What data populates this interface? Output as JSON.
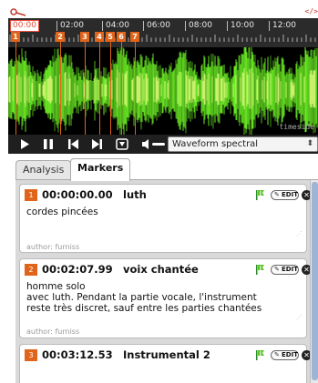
{
  "player": {
    "embed_label": "</>",
    "ruler_ticks": [
      "00:00",
      "02:00",
      "04:00",
      "06:00",
      "08:00",
      "10:00",
      "12:00"
    ],
    "marker_flags": [
      "1",
      "2",
      "3",
      "4",
      "5",
      "6",
      "7"
    ],
    "waveform_brand": "timeside",
    "view_select": {
      "selected": "Waveform spectral"
    },
    "icons": {
      "play": "play-icon",
      "pause": "pause-icon",
      "prev": "skip-back-icon",
      "next": "skip-forward-icon",
      "add_marker": "add-marker-icon",
      "volume": "volume-icon"
    },
    "colors": {
      "marker": "#e06419",
      "waveform_green": "#8fd833",
      "ruler_bg": "#2b2b2b"
    }
  },
  "tabs": [
    {
      "label": "Analysis",
      "active": false
    },
    {
      "label": "Markers",
      "active": true
    }
  ],
  "markers": [
    {
      "number": "1",
      "time": "00:00:00.00",
      "title": "luth",
      "description": [
        "cordes pincées"
      ],
      "author": "author: furniss",
      "edit_label": "EDIT"
    },
    {
      "number": "2",
      "time": "00:02:07.99",
      "title": "voix chantée",
      "description": [
        "homme solo",
        "avec luth. Pendant la partie vocale, l'instrument",
        "reste très discret, sauf entre les parties chantées"
      ],
      "author": "author: furniss",
      "edit_label": "EDIT"
    },
    {
      "number": "3",
      "time": "00:03:12.53",
      "title": "Instrumental 2",
      "description": [],
      "author": "",
      "edit_label": "EDIT"
    }
  ]
}
